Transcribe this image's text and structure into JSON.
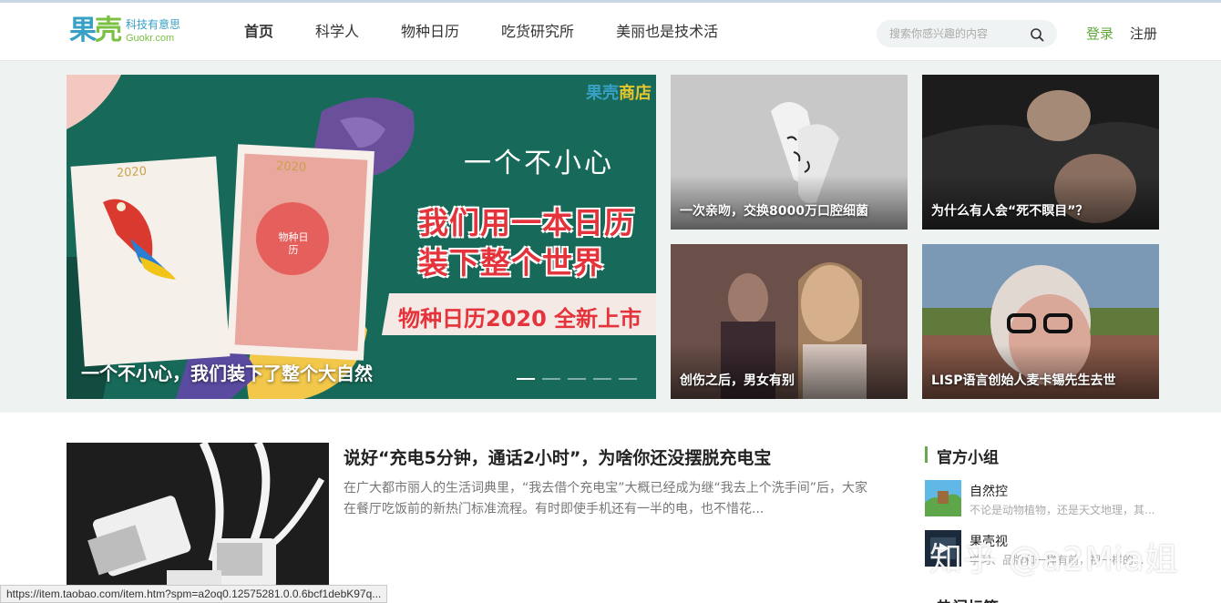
{
  "header": {
    "logo_main_1": "果",
    "logo_main_2": "壳",
    "logo_tagline": "科技有意思",
    "logo_domain": "Guokr.com",
    "nav": [
      "首页",
      "科学人",
      "物种日历",
      "吃货研究所",
      "美丽也是技术活"
    ],
    "search_placeholder": "搜索你感兴趣的内容",
    "login": "登录",
    "register": "注册"
  },
  "carousel": {
    "store_badge_1": "果壳",
    "store_badge_2": "商店",
    "line1": "一个不小心",
    "line2": "我们用一本日历",
    "line3": "装下整个世界",
    "banner": "物种日历2020 全新上市",
    "calendar_year": "2020",
    "calendar_label": "物种日历",
    "caption": "一个不小心，我们装下了整个大自然",
    "dot_count": 5,
    "active_dot": 0
  },
  "tiles": [
    {
      "caption": "一次亲吻，交换8000万口腔细菌"
    },
    {
      "caption": "为什么有人会“死不瞑目”？"
    },
    {
      "caption": "创伤之后，男女有别"
    },
    {
      "caption": "LISP语言创始人麦卡锡先生去世"
    }
  ],
  "article": {
    "title": "说好“充电5分钟，通话2小时”，为啥你还没摆脱充电宝",
    "summary": "在广大都市丽人的生活词典里，“我去借个充电宝”大概已经成为继“我去上个洗手间”后，大家在餐厅吃饭前的新热门标准流程。有时即使手机还有一半的电，也不惜花..."
  },
  "groups": {
    "heading": "官方小组",
    "items": [
      {
        "name": "自然控",
        "desc": "不论是动物植物，还是天文地理，其..."
      },
      {
        "name": "果壳视",
        "desc": "学习、品牌和一样有前，视一样的..."
      }
    ],
    "heading2": "热门标签"
  },
  "watermark": "知乎 @a2Mia姐",
  "status_url": "https://item.taobao.com/item.htm?spm=a2oq0.12575281.0.0.6bcf1debK97q...",
  "colors": {
    "brand_blue": "#37a0c4",
    "brand_green": "#7bc043",
    "login_green": "#5fa83a",
    "carousel_bg": "#176a59",
    "hero_red": "#e5333b"
  }
}
